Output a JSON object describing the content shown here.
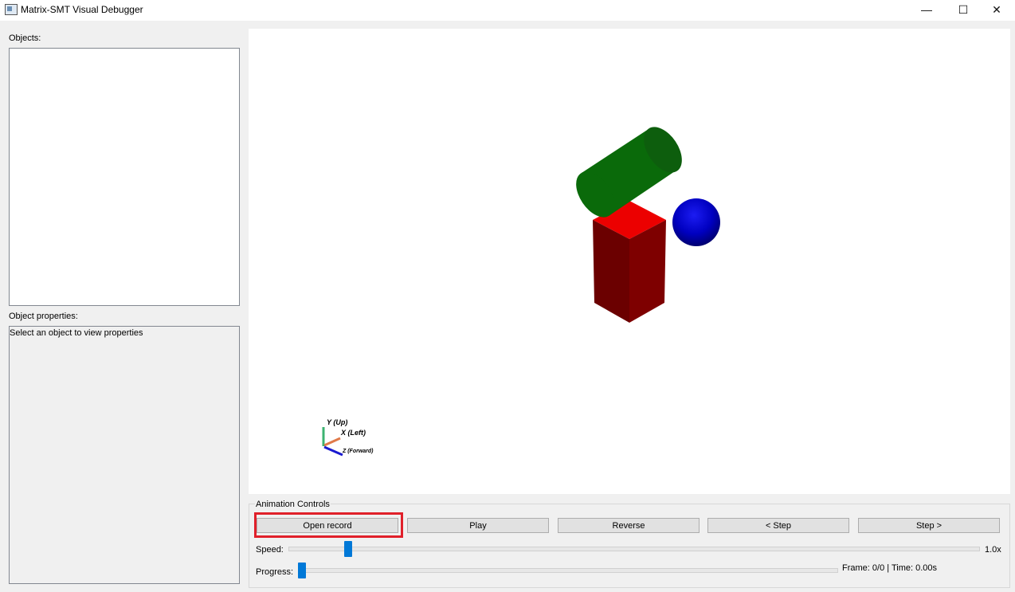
{
  "window": {
    "title": "Matrix-SMT Visual Debugger",
    "minimize": "—",
    "maximize": "☐",
    "close": "✕"
  },
  "left_panel": {
    "objects_label": "Objects:",
    "properties_label": "Object properties:",
    "properties_placeholder": "Select an object to view properties"
  },
  "viewport": {
    "axes": {
      "y_label": "Y (Up)",
      "x_label": "X (Left)",
      "z_label": "Z (Forward)"
    },
    "colors": {
      "cube": "#e00000",
      "cylinder": "#0a6e0a",
      "sphere": "#0000c8"
    }
  },
  "animation_controls": {
    "group_title": "Animation Controls",
    "buttons": {
      "open_record": "Open record",
      "play": "Play",
      "reverse": "Reverse",
      "step_back": "< Step",
      "step_forward": "Step >"
    },
    "speed_label": "Speed:",
    "speed_value": "1.0x",
    "progress_label": "Progress:",
    "frame_time": "Frame: 0/0 | Time: 0.00s"
  },
  "highlight_color": "#e0202a"
}
